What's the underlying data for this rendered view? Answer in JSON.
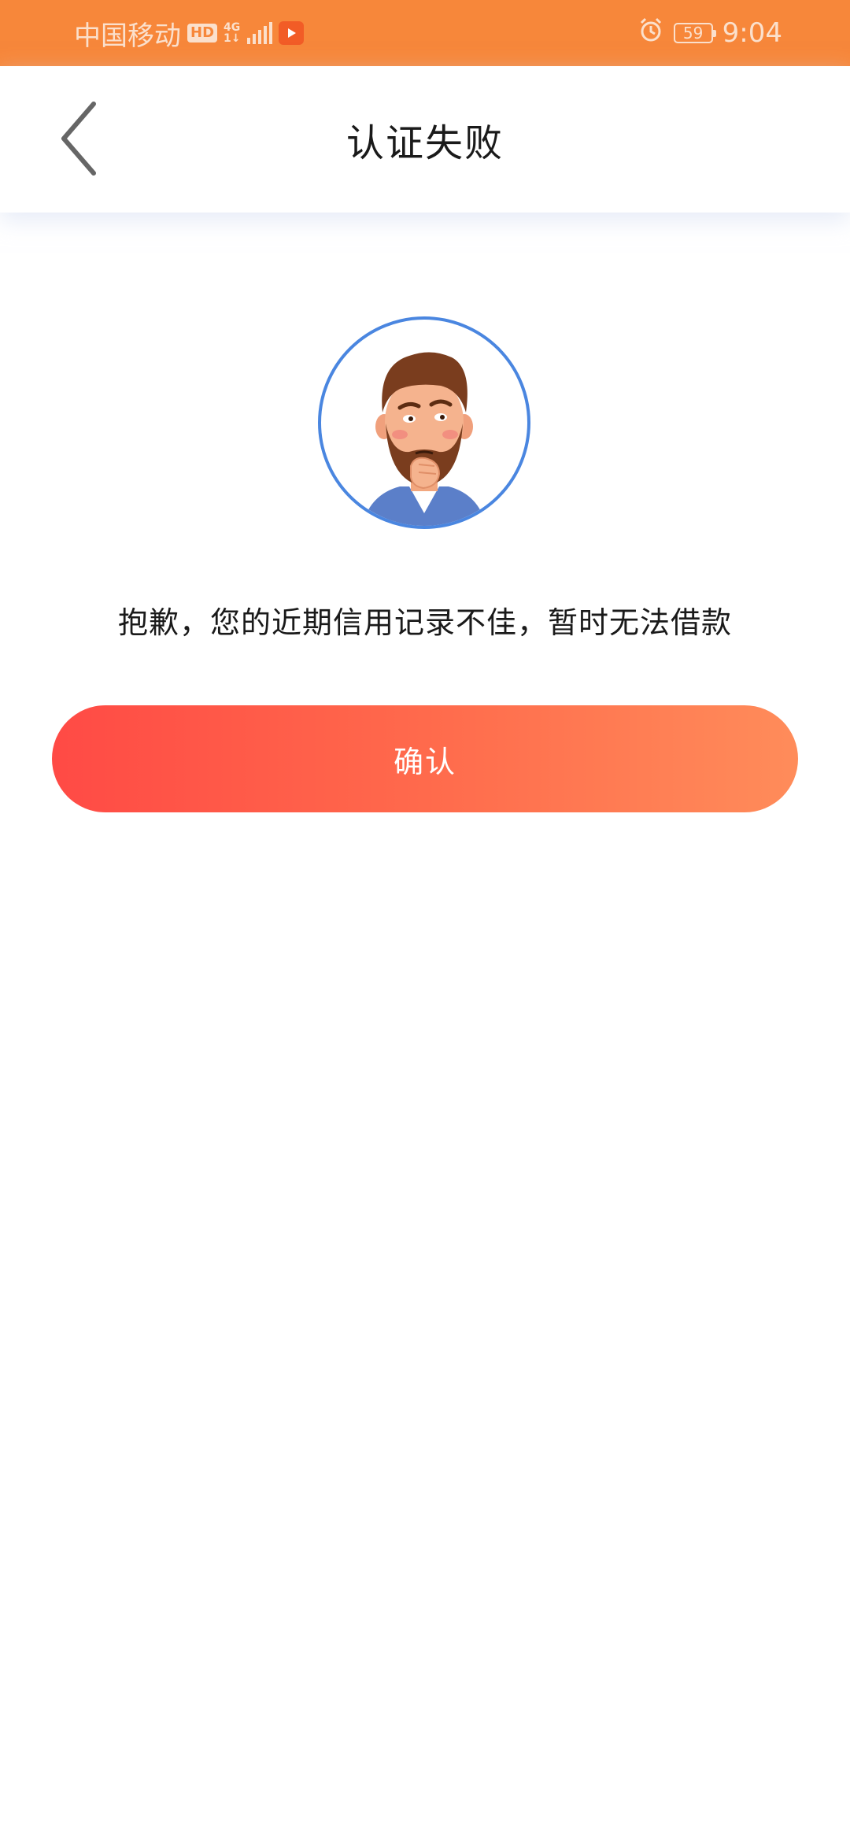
{
  "status_bar": {
    "carrier": "中国移动",
    "hd_badge": "HD",
    "network_type": "4G",
    "network_sub": "1↓",
    "battery_level": "59",
    "time": "9:04",
    "icons": [
      "hd-icon",
      "signal-icon",
      "video-app-icon",
      "alarm-icon",
      "battery-icon"
    ]
  },
  "nav": {
    "back_icon": "chevron-left-icon",
    "title": "认证失败"
  },
  "main": {
    "avatar": "thinking-man-illustration",
    "message": "抱歉，您的近期信用记录不佳，暂时无法借款",
    "confirm_label": "确认"
  },
  "colors": {
    "status_bar_bg": "#f7873a",
    "avatar_ring": "#4a86e0",
    "button_gradient_start": "#ff4a45",
    "button_gradient_end": "#ff8c5a"
  }
}
